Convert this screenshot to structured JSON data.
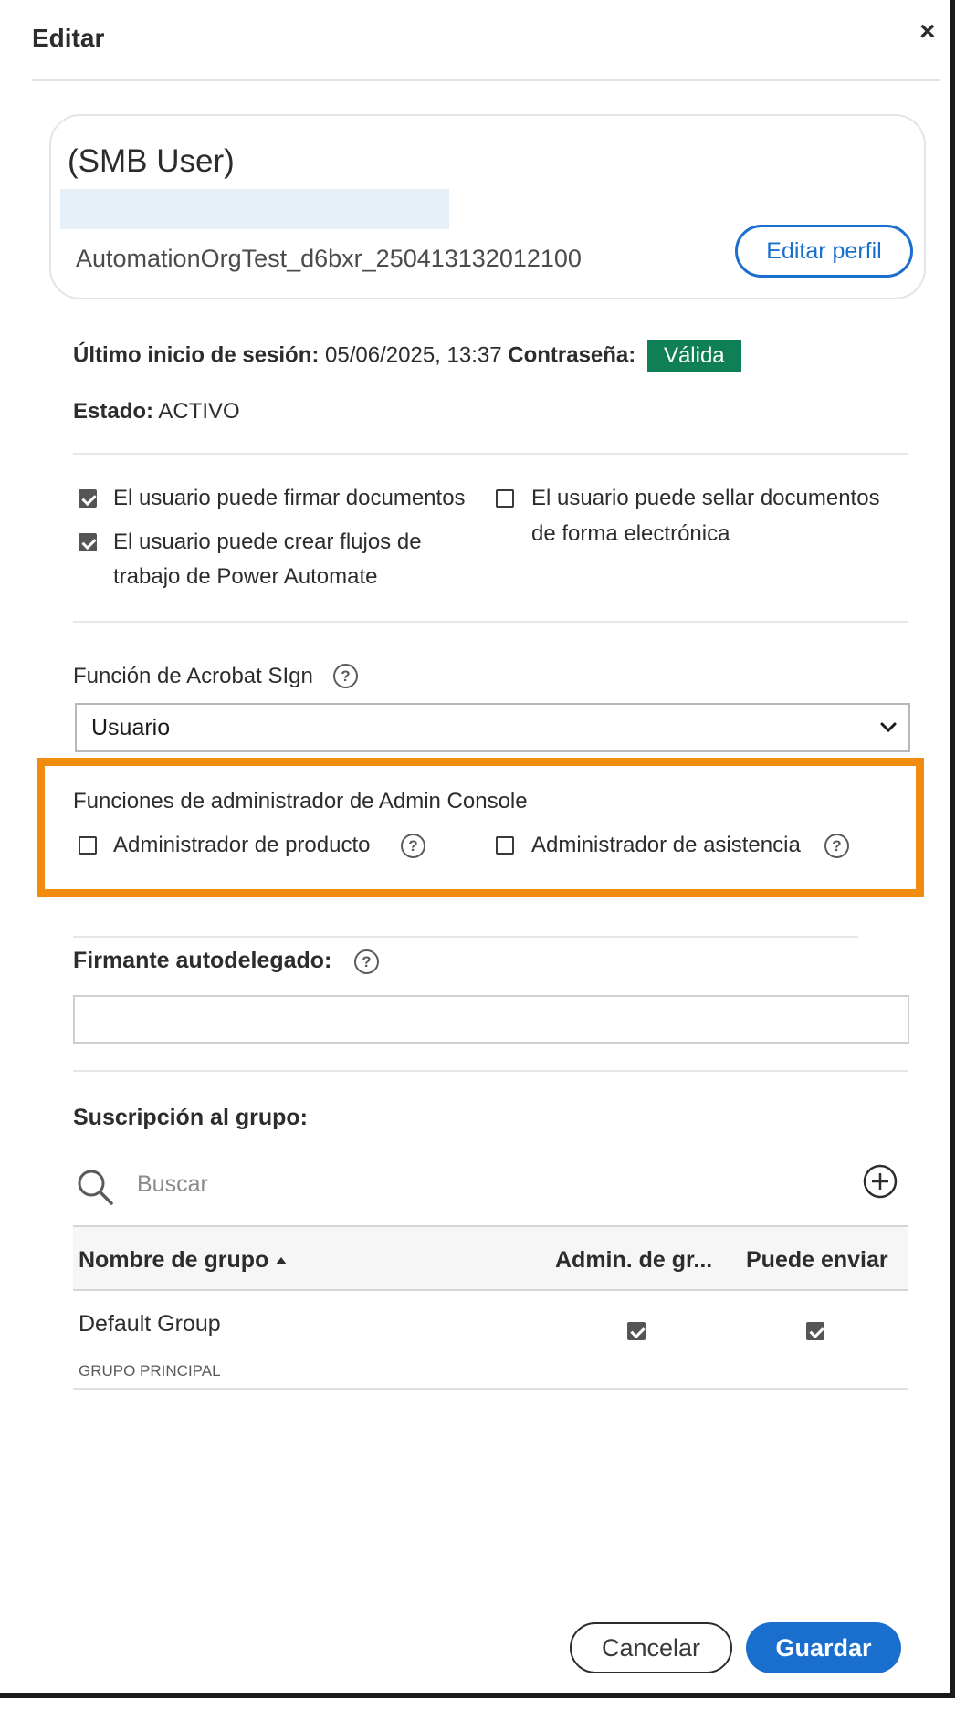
{
  "dialog": {
    "title": "Editar",
    "close_label": "×"
  },
  "profile": {
    "name": "(SMB User)",
    "org": "AutomationOrgTest_d6bxr_250413132012100",
    "edit_button": "Editar perfil"
  },
  "status": {
    "last_login_label": "Último inicio de sesión:",
    "last_login_value": "05/06/2025, 13:37",
    "password_label": "Contraseña:",
    "password_value": "Válida",
    "state_label": "Estado:",
    "state_value": "ACTIVO"
  },
  "permissions": [
    {
      "label_line1": "El usuario puede firmar documentos",
      "label_line2": "",
      "checked": true
    },
    {
      "label_line1": "El usuario puede crear flujos de",
      "label_line2": "trabajo de Power Automate",
      "checked": true
    },
    {
      "label_line1": "El usuario puede sellar documentos",
      "label_line2": "de forma electrónica",
      "checked": false
    }
  ],
  "role": {
    "label": "Función de Acrobat SIgn",
    "value": "Usuario"
  },
  "admin_roles": {
    "label": "Funciones de administrador de Admin Console",
    "product_admin": "Administrador de producto",
    "support_admin": "Administrador de asistencia"
  },
  "delegate": {
    "label": "Firmante autodelegado:",
    "value": ""
  },
  "groups": {
    "label": "Suscripción al grupo:",
    "search_placeholder": "Buscar",
    "columns": [
      "Nombre de grupo",
      "Admin. de gr...",
      "Puede enviar"
    ],
    "rows": [
      {
        "name": "Default Group",
        "tag": "GRUPO PRINCIPAL",
        "group_admin": true,
        "can_send": true
      }
    ]
  },
  "footer": {
    "cancel": "Cancelar",
    "save": "Guardar"
  },
  "colors": {
    "accent": "#1a6fce",
    "valid_badge": "#0f8055",
    "highlight": "#f28c10"
  }
}
